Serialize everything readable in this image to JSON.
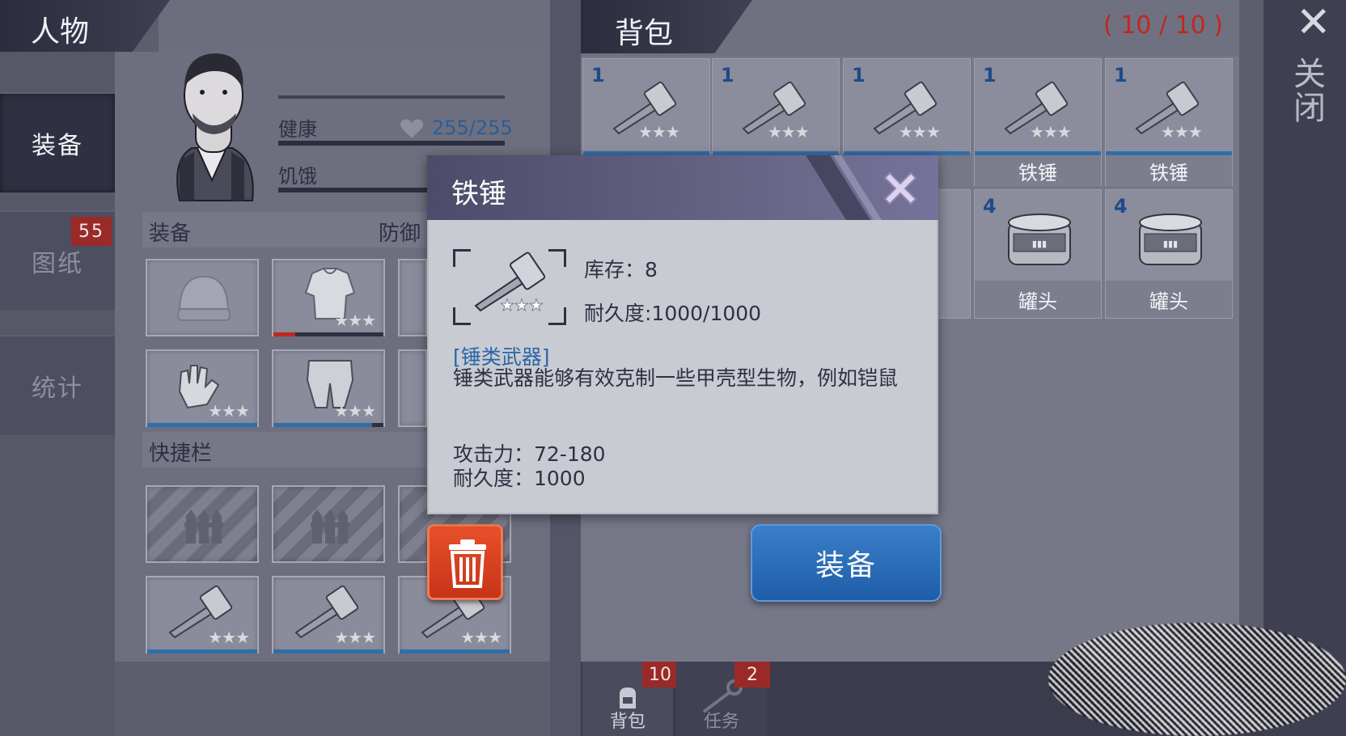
{
  "character": {
    "header": "人物",
    "tabs": [
      {
        "label": "装备"
      },
      {
        "label": "图纸",
        "badge": "55"
      },
      {
        "label": "统计"
      }
    ],
    "stats": [
      {
        "label": "健康",
        "value": "255/255"
      },
      {
        "label": "饥饿",
        "value": ""
      }
    ],
    "equipment_title": "装备",
    "defense_label": "防御",
    "quickbar_title": "快捷栏"
  },
  "inventory": {
    "header": "背包",
    "count": "( 10 / 10 )",
    "items": [
      {
        "qty": "1",
        "name": "",
        "icon": "hammer-icon"
      },
      {
        "qty": "1",
        "name": "",
        "icon": "hammer-icon"
      },
      {
        "qty": "1",
        "name": "",
        "icon": "hammer-icon"
      },
      {
        "qty": "1",
        "name": "铁锤",
        "icon": "hammer-icon"
      },
      {
        "qty": "1",
        "name": "铁锤",
        "icon": "hammer-icon"
      },
      {
        "qty": "4",
        "name": "罐头",
        "icon": "can-icon"
      },
      {
        "qty": "4",
        "name": "罐头",
        "icon": "can-icon"
      }
    ]
  },
  "close": {
    "label": "关闭"
  },
  "bottom_tabs": [
    {
      "label": "背包",
      "badge": "10"
    },
    {
      "label": "任务",
      "badge": "2"
    }
  ],
  "popup": {
    "title": "铁锤",
    "stock": "库存：8",
    "durability_line": "耐久度:1000/1000",
    "category": "[锤类武器]",
    "description": "锤类武器能够有效克制一些甲壳型生物，例如铠鼠",
    "attack": "攻击力：72-180",
    "durability": "耐久度：1000"
  },
  "equip_button": {
    "label": "装备"
  },
  "colors": {
    "accent_blue": "#2a66a8",
    "badge_red": "#9a2a28",
    "trash_red": "#d84020",
    "count_red": "#c0281e"
  }
}
